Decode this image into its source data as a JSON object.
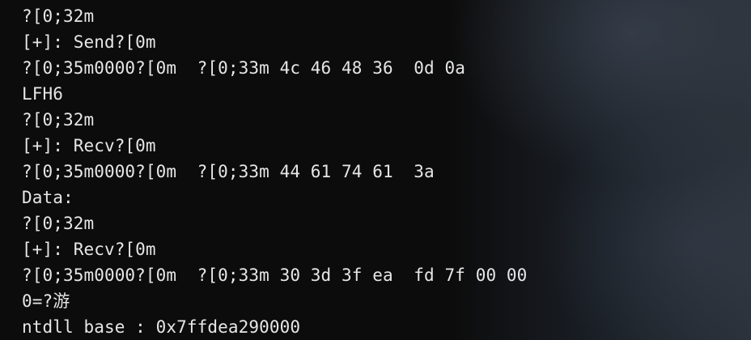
{
  "terminal": {
    "lines": [
      "?[0;32m",
      "[+]: Send?[0m",
      "?[0;35m0000?[0m  ?[0;33m 4c 46 48 36  0d 0a",
      "LFH6",
      "?[0;32m",
      "[+]: Recv?[0m",
      "?[0;35m0000?[0m  ?[0;33m 44 61 74 61  3a",
      "Data:",
      "?[0;32m",
      "[+]: Recv?[0m",
      "?[0;35m0000?[0m  ?[0;33m 30 3d 3f ea  fd 7f 00 00",
      "0=?游",
      "ntdll base : 0x7ffdea290000"
    ]
  },
  "colors": {
    "background": "#0c0c0c",
    "text": "#e6e6e6"
  }
}
